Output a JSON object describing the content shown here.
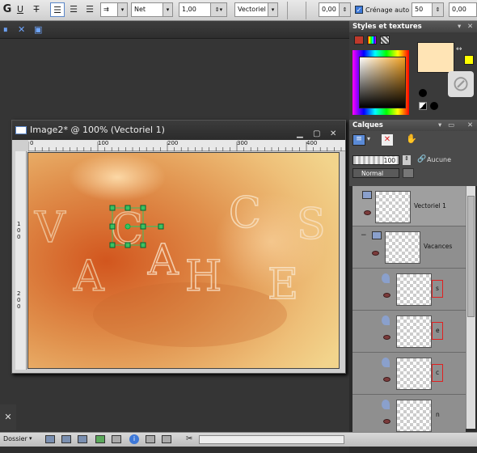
{
  "toolbar": {
    "line_style": "Net",
    "stroke_width": "1,00",
    "create_as": "Vectoriel",
    "kerning_value": "0,00",
    "auto_kerning_label": "Crénage auto",
    "auto_kerning_checked": true,
    "leading_value": "50",
    "tracking_value": "0,00"
  },
  "image_window": {
    "title": "Image2* @ 100% (Vectoriel 1)",
    "ruler_top_ticks": [
      "0",
      "100",
      "200",
      "300",
      "400"
    ],
    "ruler_left_ticks": [
      "1",
      "0",
      "0",
      "2",
      "0",
      "0"
    ],
    "canvas_letters": [
      "V",
      "C",
      "C",
      "S",
      "A",
      "A",
      "H",
      "E"
    ]
  },
  "styles_panel": {
    "title": "Styles et textures",
    "foreground_color": "#ffe4b5",
    "background_color": "#ffff00"
  },
  "layers_panel": {
    "title": "Calques",
    "opacity": "100",
    "mask_label": "Aucune",
    "blend_mode": "Normal",
    "layers": [
      {
        "name": "Vectoriel 1",
        "level": 0
      },
      {
        "name": "Vacances",
        "level": 1
      },
      {
        "name": "s",
        "level": 2
      },
      {
        "name": "e",
        "level": 2
      },
      {
        "name": "c",
        "level": 2
      },
      {
        "name": "n",
        "level": 2
      }
    ]
  },
  "statusbar": {
    "folder_label": "Dossier"
  },
  "colors": {
    "accent_blue": "#3d78d8",
    "highlight_red": "#e02020",
    "selection_green": "#3cc060"
  }
}
